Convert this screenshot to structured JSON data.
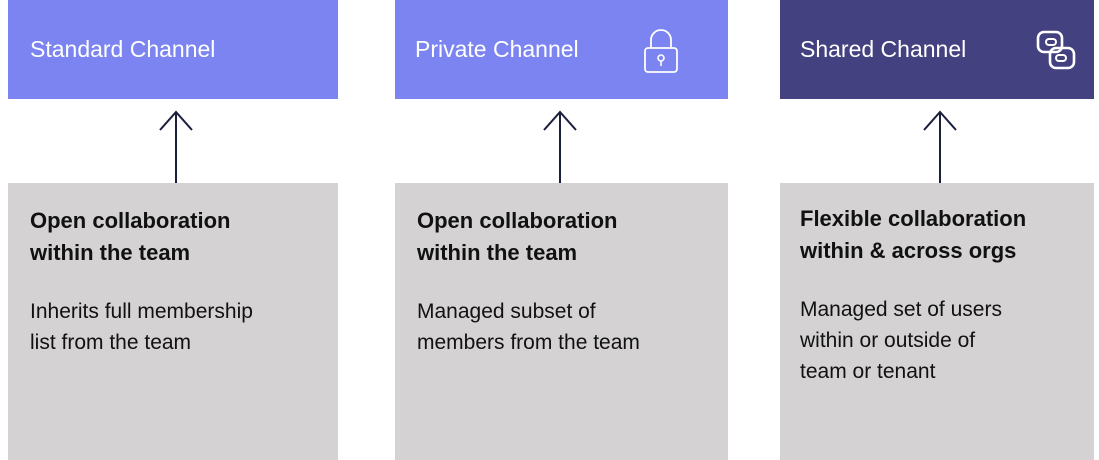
{
  "columns": [
    {
      "header": "Standard Channel",
      "header_color": "#7b84f0",
      "icon": "",
      "title_line1": "Open collaboration",
      "title_line2": "within the team",
      "desc_line1": "Inherits full membership",
      "desc_line2": "list from the team",
      "desc_line3": ""
    },
    {
      "header": "Private Channel",
      "header_color": "#7b84f0",
      "icon": "lock-icon",
      "title_line1": "Open collaboration",
      "title_line2": "within the team",
      "desc_line1": "Managed subset of",
      "desc_line2": "members from the team",
      "desc_line3": ""
    },
    {
      "header": "Shared Channel",
      "header_color": "#444180",
      "icon": "link-icon",
      "title_line1": "Flexible collaboration",
      "title_line2": "within & across orgs",
      "desc_line1": "Managed set of users",
      "desc_line2": "within or outside of",
      "desc_line3": "team or tenant"
    }
  ],
  "card_color": "#d4d2d3",
  "connector_color": "#1a1f3d"
}
